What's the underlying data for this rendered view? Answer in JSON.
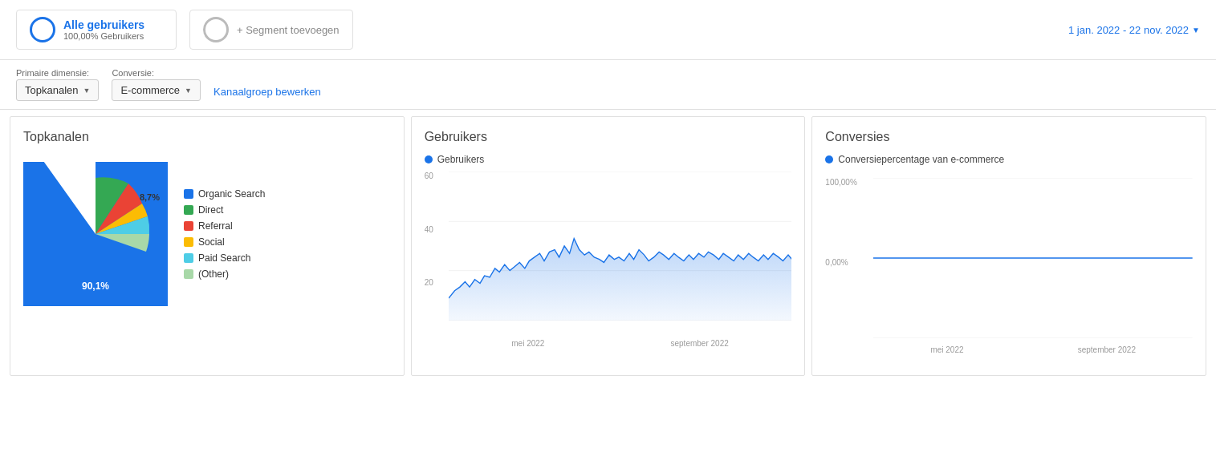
{
  "header": {
    "segment1": {
      "title": "Alle gebruikers",
      "subtitle": "100,00% Gebruikers"
    },
    "segment2": {
      "placeholder": "+ Segment toevoegen"
    },
    "dateRange": "1 jan. 2022 - 22 nov. 2022"
  },
  "controls": {
    "primaryDimensionLabel": "Primaire dimensie:",
    "conversionLabel": "Conversie:",
    "primaryDimensionValue": "Topkanalen",
    "conversionValue": "E-commerce",
    "editLink": "Kanaalgroep bewerken"
  },
  "topkanalen": {
    "title": "Topkanalen",
    "pieData": {
      "organicPercent": 90.1,
      "smallPercent": 8.7
    },
    "legend": [
      {
        "label": "Organic Search",
        "color": "#1a73e8"
      },
      {
        "label": "Direct",
        "color": "#34a853"
      },
      {
        "label": "Referral",
        "color": "#ea4335"
      },
      {
        "label": "Social",
        "color": "#fbbc04"
      },
      {
        "label": "Paid Search",
        "color": "#4ecde6"
      },
      {
        "label": "(Other)",
        "color": "#a8d8a8"
      }
    ]
  },
  "gebruikers": {
    "title": "Gebruikers",
    "legendLabel": "Gebruikers",
    "yAxis": [
      "60",
      "40",
      "20"
    ],
    "xAxis": [
      "mei 2022",
      "september 2022"
    ],
    "color": "#1a73e8"
  },
  "conversies": {
    "title": "Conversies",
    "legendLabel": "Conversiepercentage van e-commerce",
    "yAxisTop": "100,00%",
    "yAxisBottom": "0,00%",
    "xAxis": [
      "mei 2022",
      "september 2022"
    ],
    "color": "#1a73e8"
  }
}
